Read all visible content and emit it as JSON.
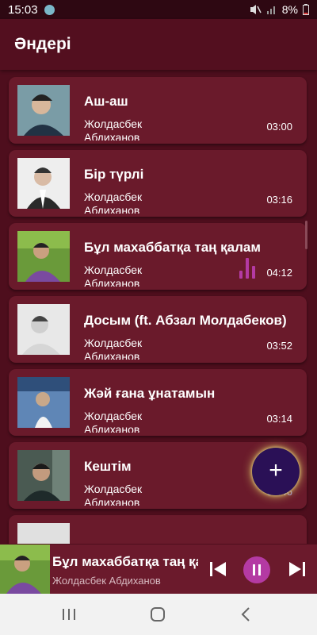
{
  "status_bar": {
    "time": "15:03",
    "battery": "8%",
    "icons": [
      "whatsapp-icon",
      "mute-icon",
      "signal-icon",
      "battery-icon"
    ]
  },
  "app_bar": {
    "title": "Әндері"
  },
  "songs": [
    {
      "title": "Аш-аш",
      "artist": "Жолдасбек Абдиханов",
      "duration": "03:00"
    },
    {
      "title": "Бір түрлі",
      "artist": "Жолдасбек Абдиханов",
      "duration": "03:16"
    },
    {
      "title": "Бұл махаббатқа таң қалам",
      "artist": "Жолдасбек Абдиханов",
      "duration": "04:12"
    },
    {
      "title": "Досым (ft. Абзал Молдабеков)",
      "artist": "Жолдасбек Абдиханов",
      "duration": "03:52"
    },
    {
      "title": "Жәй ғана ұнатамын",
      "artist": "Жолдасбек Абдиханов",
      "duration": "03:14"
    },
    {
      "title": "Кештім",
      "artist": "Жолдасбек Абдиханов",
      "duration": "03:46"
    }
  ],
  "fab": {
    "label": "+"
  },
  "now_playing": {
    "title": "Бұл махаббатқа таң қалам",
    "artist": "Жолдасбек Абдиханов"
  },
  "colors": {
    "background": "#4e0e1d",
    "card": "#6a1a2b",
    "accent": "#b43aa3",
    "fab": "#2a1056"
  }
}
